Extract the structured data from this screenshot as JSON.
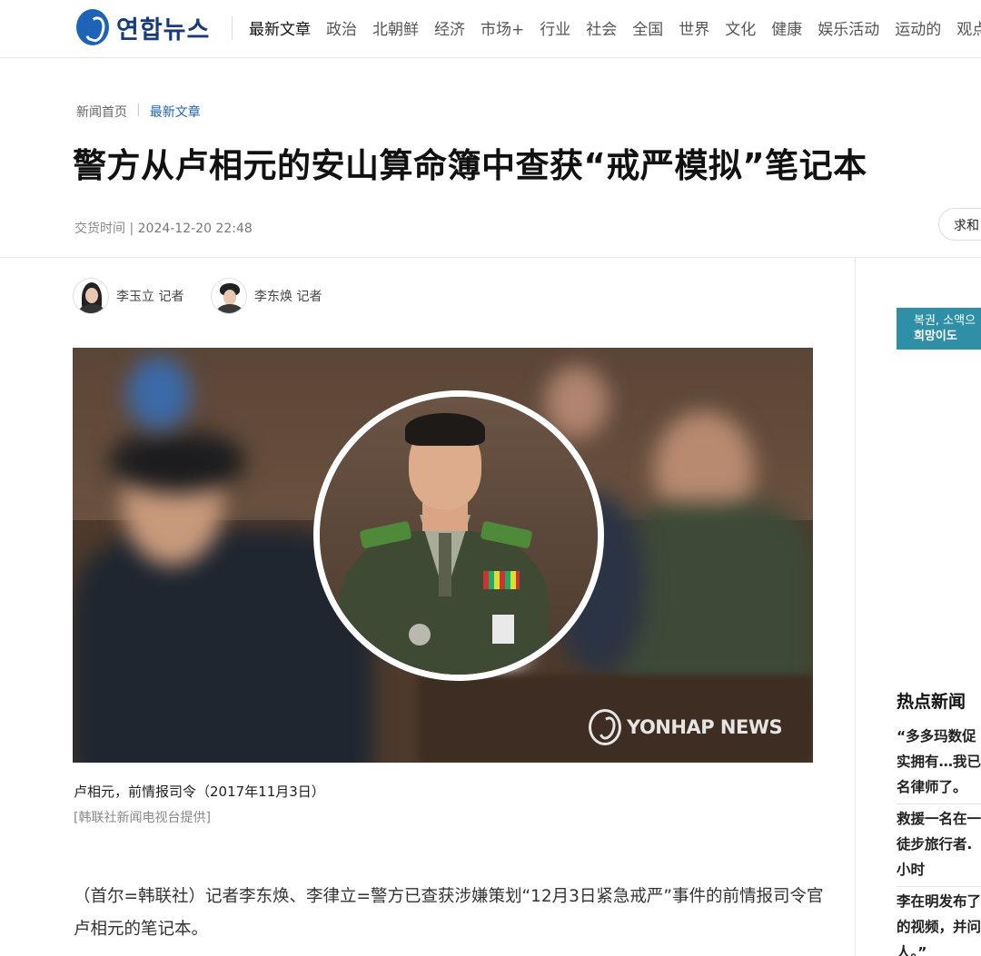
{
  "header": {
    "logo_text": "연합뉴스",
    "nav": [
      "最新文章",
      "政治",
      "北朝鲜",
      "经济",
      "市场+",
      "行业",
      "社会",
      "全国",
      "世界",
      "文化",
      "健康",
      "娱乐活动",
      "运动的",
      "观点"
    ]
  },
  "breadcrumb": {
    "home": "新闻首页",
    "current": "最新文章"
  },
  "article": {
    "title": "警方从卢相元的安山算命簿中查获“戒严模拟”笔记本",
    "time_label": "交货时间",
    "time_value": "2024-12-20 22:48",
    "share_label": "求和"
  },
  "authors": [
    {
      "name": "李玉立 记者"
    },
    {
      "name": "李东焕 记者"
    }
  ],
  "photo": {
    "watermark": "YONHAP NEWS",
    "caption": "卢相元，前情报司令（2017年11月3日）",
    "credit": "[韩联社新闻电视台提供]"
  },
  "body": {
    "paragraph": "（首尔=韩联社）记者李东焕、李律立=警方已查获涉嫌策划“12月3日紧急戒严”事件的前情报司令官卢相元的笔记本。"
  },
  "sidebar": {
    "ad_line1": "복권, 소액으",
    "ad_line2": "희망이도",
    "hot_title": "热点新闻",
    "hot_items": [
      [
        "“多多玛数促",
        "实拥有…我已",
        "名律师了。"
      ],
      [
        "救援一名在一",
        "徒步旅行者.",
        "小时"
      ],
      [
        "李在明发布了",
        "的视频，并问",
        "人。”"
      ]
    ]
  }
}
